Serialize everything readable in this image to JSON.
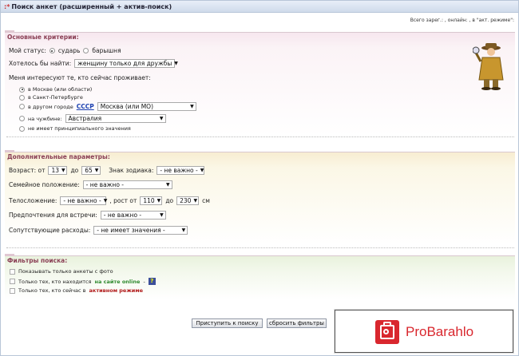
{
  "title": "Поиск анкет (расширенный + актив-поиск)",
  "stats": "Всего зарег.: , онлайн: , в \"акт. режиме\":",
  "basic": {
    "header": "Основные критерии:",
    "status_label": "Мой статус:",
    "status_options": [
      "сударь",
      "барышня"
    ],
    "find_label": "Хотелось бы найти:",
    "find_value": "женщину только для дружбы",
    "interest_label": "Меня интересуют те, кто сейчас проживает:",
    "loc_moscow": "в Москве (или области)",
    "loc_spb": "в Санкт-Петербурге",
    "loc_other_prefix": "в другом городе",
    "loc_other_link": "СССР",
    "loc_other_value": "Москва (или МО)",
    "loc_abroad": "на чужбине:",
    "loc_abroad_value": "Австралия",
    "loc_any": "не имеет принципиального значения"
  },
  "extra": {
    "header": "Дополнительные параметры:",
    "age_label": "Возраст: от",
    "age_from": "13",
    "age_to_label": "до",
    "age_to": "65",
    "zodiac_label": "Знак зодиака:",
    "zodiac_value": "- не важно -",
    "family_label": "Семейное положение:",
    "family_value": "- не важно -",
    "body_label": "Телосложение:",
    "body_value": "- не важно -",
    "height_label": ", рост от",
    "height_from": "110",
    "height_to_label": "до",
    "height_to": "230",
    "height_unit": "см",
    "meet_label": "Предпочтения для встречи:",
    "meet_value": "- не важно -",
    "expense_label": "Сопутствующие расходы:",
    "expense_value": "- не имеет значения -"
  },
  "filters": {
    "header": "Фильтры поиска:",
    "photo": "Показывать только анкеты с фото",
    "online_prefix": "Только тех, кто находится",
    "online_highlight": "на сайте online",
    "online_suffix": "-",
    "online_badge": "?",
    "active_prefix": "Только тех, кто сейчас в",
    "active_highlight": "активном режиме"
  },
  "buttons": {
    "search": "Приступить к поиску",
    "reset": "сбросить фильтры"
  },
  "banner": {
    "text": "ProBarahlo"
  },
  "colors": {
    "accent_red": "#d9272e",
    "section_header": "#8a3f55",
    "link": "#1a3fb0"
  }
}
